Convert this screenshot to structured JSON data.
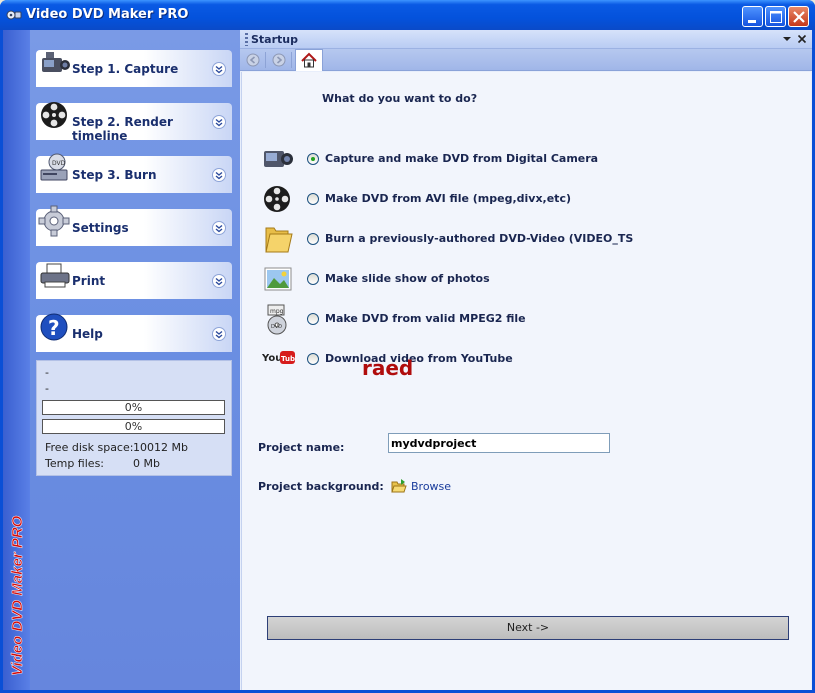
{
  "window": {
    "title": "Video DVD Maker PRO"
  },
  "brand": {
    "vertical_text": "Video DVD Maker PRO"
  },
  "sidebar": {
    "steps": [
      {
        "label": "Step 1. Capture",
        "icon": "camcorder-icon"
      },
      {
        "label": "Step 2. Render timeline",
        "icon": "film-reel-icon"
      },
      {
        "label": "Step 3. Burn",
        "icon": "dvd-drive-icon"
      },
      {
        "label": "Settings",
        "icon": "gear-icon"
      },
      {
        "label": "Print",
        "icon": "printer-icon"
      },
      {
        "label": "Help",
        "icon": "help-icon"
      }
    ],
    "stats": {
      "line1": "-",
      "line2": "-",
      "progress1": "0%",
      "progress2": "0%",
      "free_disk_label": "Free disk space:",
      "free_disk_value": "10012 Mb",
      "temp_files_label": "Temp files:",
      "temp_files_value": "0 Mb"
    }
  },
  "panel": {
    "title": "Startup",
    "question": "What do you want to do?",
    "options": [
      {
        "label": "Capture and make DVD from Digital Camera",
        "icon": "camcorder-icon",
        "checked": true
      },
      {
        "label": "Make DVD from AVI file (mpeg,divx,etc)",
        "icon": "film-reel-icon",
        "checked": false
      },
      {
        "label": "Burn a previously-authored DVD-Video (VIDEO_TS",
        "icon": "folder-icon",
        "checked": false
      },
      {
        "label": "Make slide show of photos",
        "icon": "photo-icon",
        "checked": false
      },
      {
        "label": "Make DVD from valid MPEG2 file",
        "icon": "mpeg-dvd-icon",
        "checked": false
      },
      {
        "label": "Download video from YouTube",
        "icon": "youtube-icon",
        "checked": false
      }
    ],
    "watermark": "raed",
    "project_name_label": "Project name:",
    "project_name_value": "mydvdproject",
    "project_background_label": "Project background:",
    "browse_label": "Browse",
    "next_label": "Next ->"
  },
  "colors": {
    "title_bar": "#0a4fd6",
    "sidebar": "#6a8ee2",
    "panel_bg": "#f2f5fc",
    "watermark": "#b00c0c",
    "selected_radio": "#21a121"
  }
}
